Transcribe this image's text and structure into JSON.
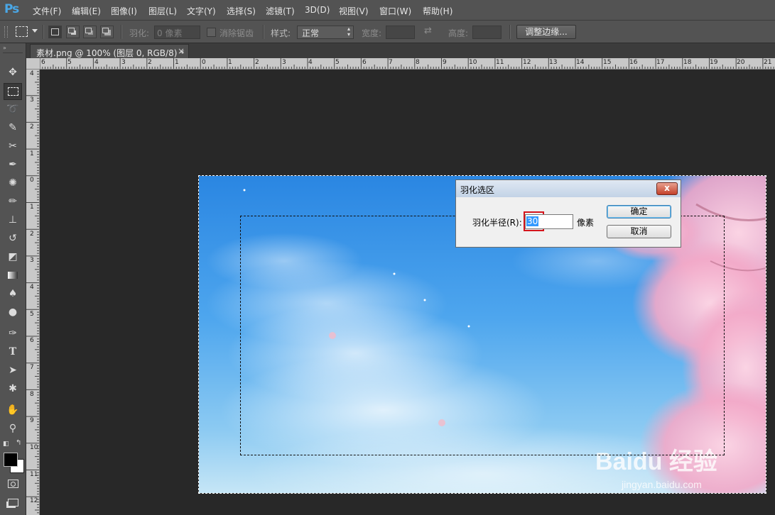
{
  "app": {
    "logo": "Ps"
  },
  "menu": [
    "文件(F)",
    "编辑(E)",
    "图像(I)",
    "图层(L)",
    "文字(Y)",
    "选择(S)",
    "滤镜(T)",
    "3D(D)",
    "视图(V)",
    "窗口(W)",
    "帮助(H)"
  ],
  "options": {
    "feather_label": "羽化:",
    "feather_value": "0 像素",
    "antialias_label": "消除锯齿",
    "style_label": "样式:",
    "style_value": "正常",
    "width_label": "宽度:",
    "height_label": "高度:",
    "refine_button": "调整边缘..."
  },
  "document": {
    "tab_title": "素材.png @ 100% (图层 0, RGB/8) *",
    "close": "×"
  },
  "ruler": {
    "h_labels": [
      "6",
      "5",
      "4",
      "3",
      "2",
      "1",
      "0",
      "1",
      "2",
      "3",
      "4",
      "5",
      "6",
      "7",
      "8",
      "9",
      "10",
      "11",
      "12",
      "13",
      "14",
      "15",
      "16",
      "17",
      "18",
      "19",
      "20",
      "21"
    ],
    "v_labels": [
      "4",
      "3",
      "2",
      "1",
      "0",
      "1",
      "2",
      "3",
      "4",
      "5",
      "6",
      "7",
      "8",
      "9",
      "10",
      "11",
      "12"
    ]
  },
  "dialog": {
    "title": "羽化选区",
    "close_glyph": "x",
    "radius_label": "羽化半径(R):",
    "radius_value": "30",
    "unit": "像素",
    "ok": "确定",
    "cancel": "取消"
  },
  "watermark": {
    "line1": "Baidu 经验",
    "line2": "jingyan.baidu.com"
  },
  "colors": {
    "highlight_box": "#d4141c",
    "selected_text_bg": "#3399ff",
    "ps_blue": "#4aa7e6"
  }
}
